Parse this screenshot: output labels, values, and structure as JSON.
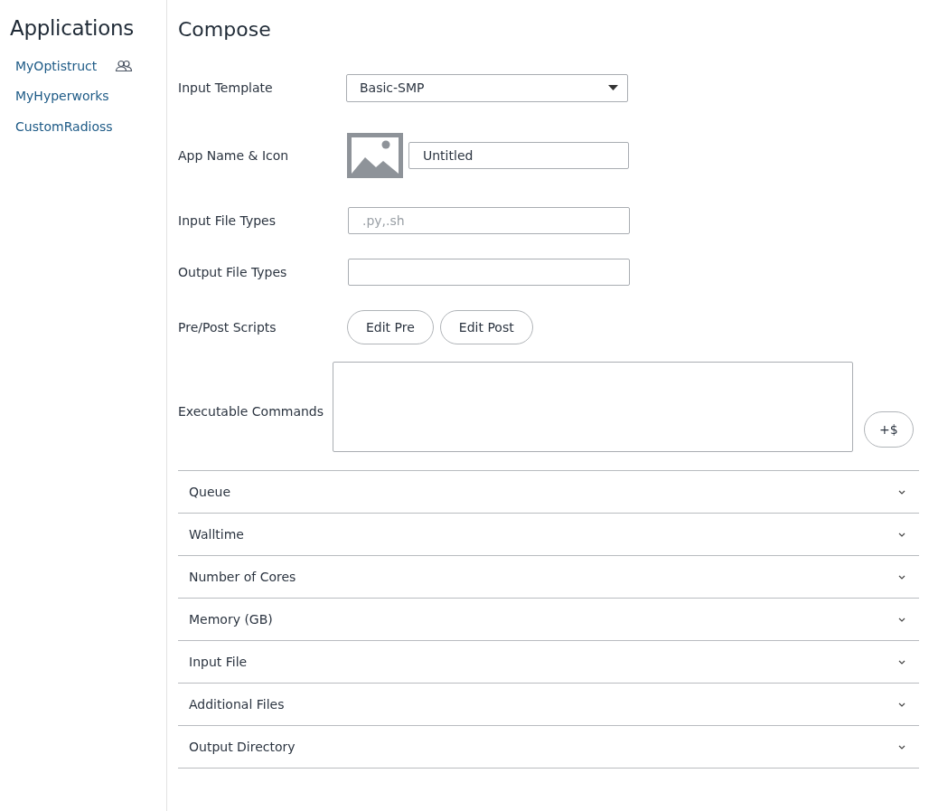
{
  "sidebar": {
    "title": "Applications",
    "items": [
      {
        "label": "MyOptistruct",
        "shared": true
      },
      {
        "label": "MyHyperworks",
        "shared": false
      },
      {
        "label": "CustomRadioss",
        "shared": false
      }
    ]
  },
  "compose": {
    "title": "Compose",
    "fields": [
      {
        "kind": "select",
        "label": "Input Template",
        "value": "Basic-SMP"
      },
      {
        "kind": "icon-text",
        "label": "App Name & Icon",
        "value": "Untitled"
      },
      {
        "kind": "text",
        "label": "Input File Types",
        "placeholder": ".py,.sh"
      },
      {
        "kind": "text",
        "label": "Output File Types"
      },
      {
        "kind": "buttons",
        "label": "Pre/Post Scripts",
        "buttons": [
          "Edit Pre",
          "Edit Post"
        ]
      },
      {
        "kind": "textarea",
        "label": "Executable Commands",
        "button": "+$"
      }
    ],
    "sections": [
      {
        "label": "Queue",
        "expanded": false
      },
      {
        "label": "Walltime",
        "expanded": false
      },
      {
        "label": "Number of Cores",
        "expanded": false
      },
      {
        "label": "Memory (GB)",
        "expanded": false
      },
      {
        "label": "Input File",
        "expanded": false
      },
      {
        "label": "Additional Files",
        "expanded": false
      },
      {
        "label": "Output Directory",
        "expanded": false
      }
    ]
  }
}
